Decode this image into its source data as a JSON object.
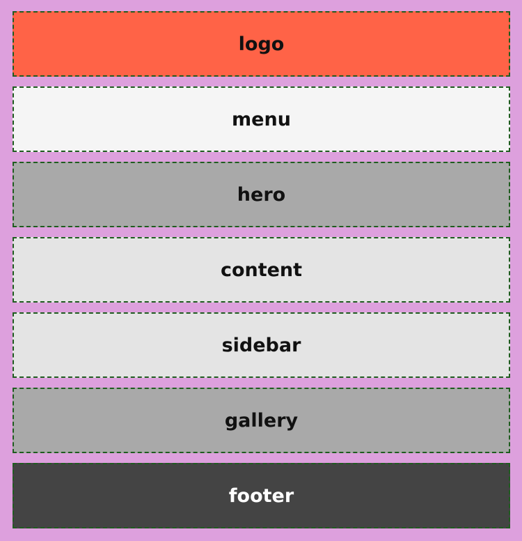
{
  "blocks": {
    "logo": "logo",
    "menu": "menu",
    "hero": "hero",
    "content": "content",
    "sidebar": "sidebar",
    "gallery": "gallery",
    "footer": "footer"
  },
  "colors": {
    "page_background": "#dda0dd",
    "logo": "#ff6347",
    "menu": "#f5f5f5",
    "hero": "#a9a9a9",
    "content": "#e4e4e4",
    "sidebar": "#e4e4e4",
    "gallery": "#a9a9a9",
    "footer": "#444444",
    "border": "#1f5c1f"
  }
}
